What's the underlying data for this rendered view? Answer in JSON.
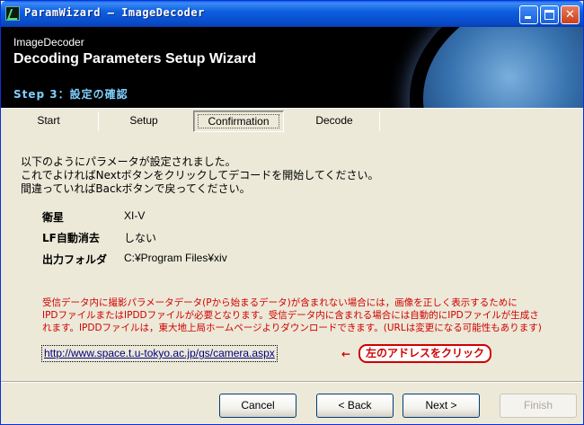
{
  "window": {
    "title": "ParamWizard – ImageDecoder"
  },
  "header": {
    "subtitle": "ImageDecoder",
    "title": "Decoding Parameters Setup Wizard",
    "step": "Step 3：設定の確認"
  },
  "tabs": [
    {
      "label": "Start",
      "active": false
    },
    {
      "label": "Setup",
      "active": false
    },
    {
      "label": "Confirmation",
      "active": true
    },
    {
      "label": "Decode",
      "active": false
    }
  ],
  "intro": {
    "line1": "以下のようにパラメータが設定されました。",
    "line2": "これでよければNextボタンをクリックしてデコードを開始してください。",
    "line3": "間違っていればBackボタンで戻ってください。"
  },
  "params": [
    {
      "label": "衛星",
      "value": "XI-V"
    },
    {
      "label": "LF自動消去",
      "value": "しない"
    },
    {
      "label": "出力フォルダ",
      "value": "C:¥Program Files¥xiv"
    }
  ],
  "note": {
    "line1": "受信データ内に撮影パラメータデータ(Pから始まるデータ)が含まれない場合には，画像を正しく表示するために",
    "line2": "IPDファイルまたはIPDDファイルが必要となります。受信データ内に含まれる場合には自動的にIPDファイルが生成さ",
    "line3": "れます。IPDDファイルは，東大地上局ホームページよりダウンロードできます。(URLは変更になる可能性もあります)"
  },
  "link": {
    "url": "http://www.space.t.u-tokyo.ac.jp/gs/camera.aspx",
    "arrow": "←",
    "callout": "左のアドレスをクリック"
  },
  "buttons": {
    "cancel": "Cancel",
    "back": "< Back",
    "next": "Next >",
    "finish": "Finish"
  },
  "colors": {
    "titlebar": "#0a56d8",
    "note_red": "#d00000",
    "step_text": "#7fd0ff"
  }
}
